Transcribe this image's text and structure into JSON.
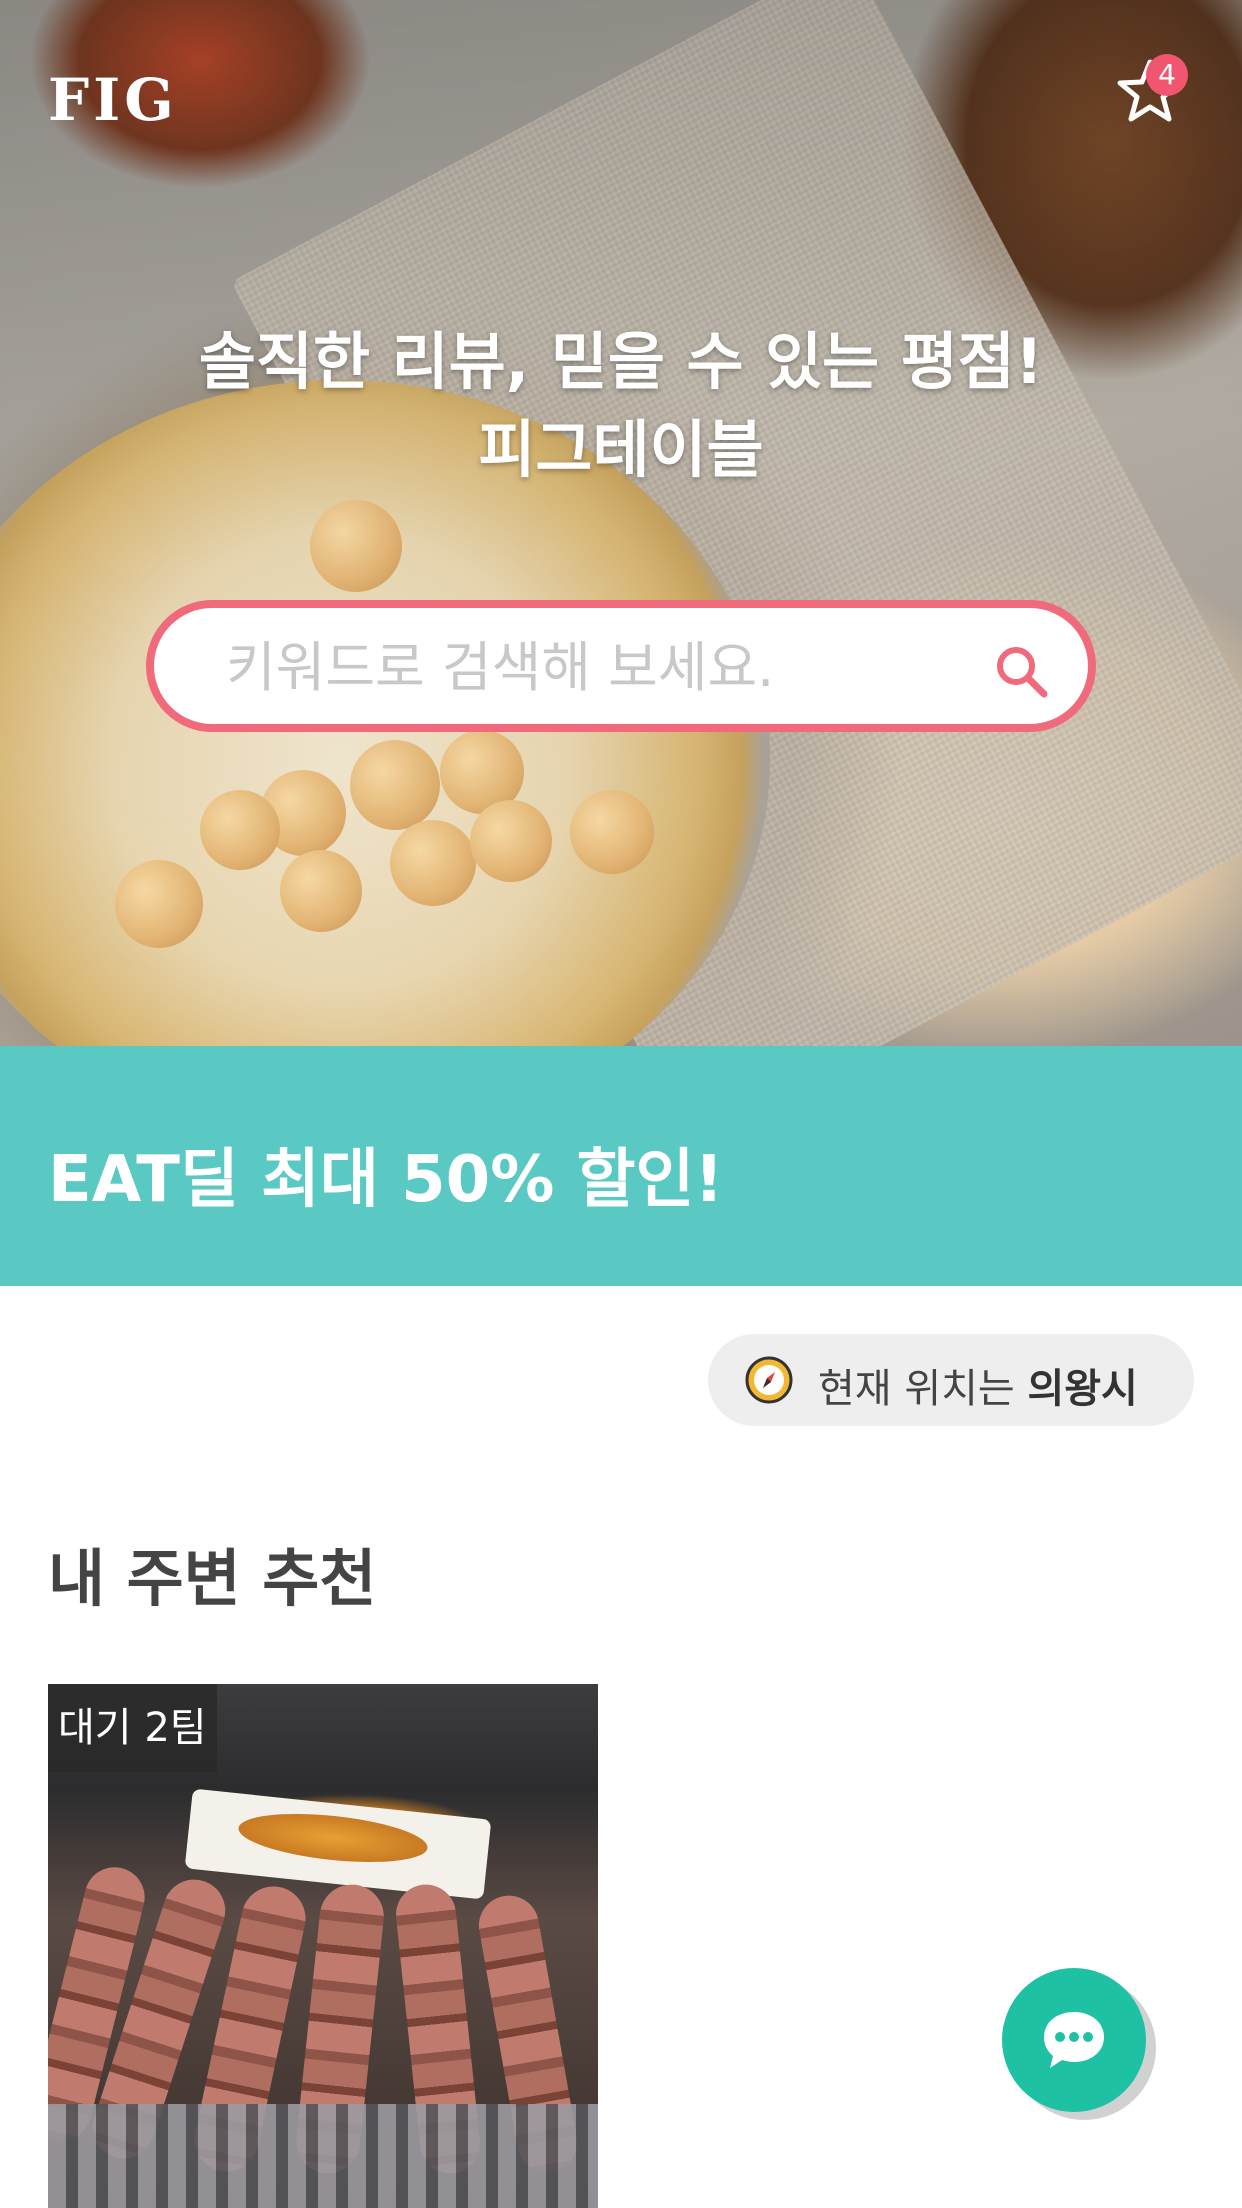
{
  "header": {
    "logo": "FIG",
    "favorites_badge": "4"
  },
  "hero": {
    "headline_line1": "솔직한 리뷰, 믿을 수 있는 평점!",
    "headline_line2": "피그테이블"
  },
  "search": {
    "placeholder": "키워드로 검색해 보세요."
  },
  "promo": {
    "text": "EAT딜 최대 50% 할인!",
    "color": "#5bc9c3"
  },
  "location": {
    "prefix": "현재 위치는",
    "city": "의왕시"
  },
  "nearby": {
    "title": "내 주변 추천",
    "items": [
      {
        "badge": "대기 2팀"
      }
    ]
  },
  "colors": {
    "accent": "#f06a7c",
    "fab": "#1ec1a3"
  }
}
